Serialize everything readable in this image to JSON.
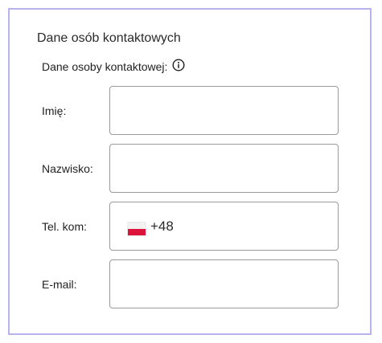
{
  "section": {
    "title": "Dane osób kontaktowych",
    "subtitle": "Dane osoby kontaktowej:"
  },
  "fields": {
    "first_name": {
      "label": "Imię:",
      "value": ""
    },
    "last_name": {
      "label": "Nazwisko:",
      "value": ""
    },
    "phone": {
      "label": "Tel. kom:",
      "country": "PL",
      "flag_icon": "poland-flag-icon",
      "dial_code": "+48",
      "value": ""
    },
    "email": {
      "label": "E-mail:",
      "value": ""
    }
  },
  "icons": {
    "info": "info-circle-icon"
  },
  "colors": {
    "panel_border": "#b7b3ec",
    "field_border": "#9a9a9a",
    "flag_red": "#dc143c"
  }
}
